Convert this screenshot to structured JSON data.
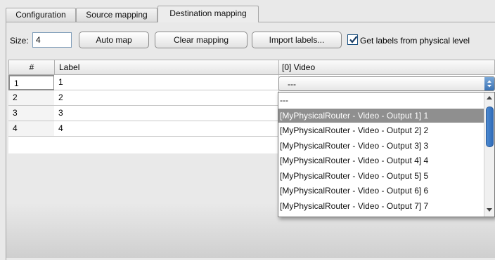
{
  "tabs": [
    {
      "label": "Configuration"
    },
    {
      "label": "Source mapping"
    },
    {
      "label": "Destination mapping"
    }
  ],
  "toolbar": {
    "size_label": "Size:",
    "size_value": "4",
    "auto_map": "Auto map",
    "clear_mapping": "Clear mapping",
    "import_labels": "Import labels...",
    "get_labels_checkbox": "Get labels from physical level",
    "get_labels_checked": true
  },
  "table": {
    "columns": [
      "#",
      "Label",
      "[0] Video"
    ],
    "rows": [
      {
        "num": "1",
        "label": "1"
      },
      {
        "num": "2",
        "label": "2"
      },
      {
        "num": "3",
        "label": "3"
      },
      {
        "num": "4",
        "label": "4"
      }
    ]
  },
  "combo": {
    "value": "---"
  },
  "dropdown": {
    "options": [
      "---",
      "[MyPhysicalRouter - Video - Output 1] 1",
      "[MyPhysicalRouter - Video - Output 2] 2",
      "[MyPhysicalRouter - Video - Output 3] 3",
      "[MyPhysicalRouter - Video - Output 4] 4",
      "[MyPhysicalRouter - Video - Output 5] 5",
      "[MyPhysicalRouter - Video - Output 6] 6",
      "[MyPhysicalRouter - Video - Output 7] 7"
    ],
    "selected_index": 1
  },
  "colors": {
    "selection": "#8f8f8f",
    "accent": "#3a72b4"
  }
}
